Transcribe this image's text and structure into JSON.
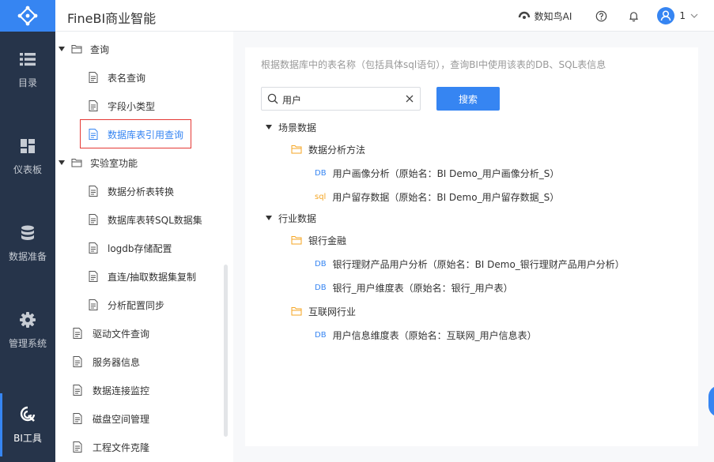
{
  "app": {
    "title": "FineBI商业智能",
    "ai_label": "数知鸟AI",
    "user_label": "1"
  },
  "sidebar": {
    "items": [
      {
        "label": "目录",
        "icon": "list-icon"
      },
      {
        "label": "仪表板",
        "icon": "dashboard-icon"
      },
      {
        "label": "数据准备",
        "icon": "database-icon"
      },
      {
        "label": "管理系统",
        "icon": "gear-icon"
      },
      {
        "label": "BI工具",
        "icon": "tool-icon"
      }
    ]
  },
  "tree": {
    "items": [
      {
        "label": "查询",
        "type": "folder"
      },
      {
        "label": "表名查询",
        "type": "file"
      },
      {
        "label": "字段小类型",
        "type": "file"
      },
      {
        "label": "数据库表引用查询",
        "type": "file",
        "selected": true
      },
      {
        "label": "实验室功能",
        "type": "folder"
      },
      {
        "label": "数据分析表转换",
        "type": "file"
      },
      {
        "label": "数据库表转SQL数据集",
        "type": "file"
      },
      {
        "label": "logdb存储配置",
        "type": "file"
      },
      {
        "label": "直连/抽取数据集复制",
        "type": "file"
      },
      {
        "label": "分析配置同步",
        "type": "file"
      },
      {
        "label": "驱动文件查询",
        "type": "file"
      },
      {
        "label": "服务器信息",
        "type": "file"
      },
      {
        "label": "数据连接监控",
        "type": "file"
      },
      {
        "label": "磁盘空间管理",
        "type": "file"
      },
      {
        "label": "工程文件克隆",
        "type": "file"
      }
    ]
  },
  "main": {
    "hint": "根据数据库中的表名称（包括具体sql语句），查询BI中使用该表的DB、SQL表信息",
    "search_value": "用户",
    "search_button": "搜索",
    "results": [
      {
        "label": "场景数据",
        "kind": "group"
      },
      {
        "label": "数据分析方法",
        "kind": "folder"
      },
      {
        "tag": "DB",
        "label": "用户画像分析（原始名：BI Demo_用户画像分析_S）",
        "kind": "table"
      },
      {
        "tag": "sql",
        "label": "用户留存数据（原始名：BI Demo_用户留存数据_S）",
        "kind": "table"
      },
      {
        "label": "行业数据",
        "kind": "group"
      },
      {
        "label": "银行金融",
        "kind": "folder"
      },
      {
        "tag": "DB",
        "label": "银行理财产品用户分析（原始名：BI Demo_银行理财产品用户分析）",
        "kind": "table"
      },
      {
        "tag": "DB",
        "label": "银行_用户维度表（原始名：银行_用户表）",
        "kind": "table"
      },
      {
        "label": "互联网行业",
        "kind": "folder"
      },
      {
        "tag": "DB",
        "label": "用户信息维度表（原始名：互联网_用户信息表）",
        "kind": "table"
      }
    ]
  },
  "colors": {
    "accent": "#3685f2",
    "sidebar_bg": "#26344a",
    "folder": "#f5a623",
    "highlight": "#e53935"
  }
}
